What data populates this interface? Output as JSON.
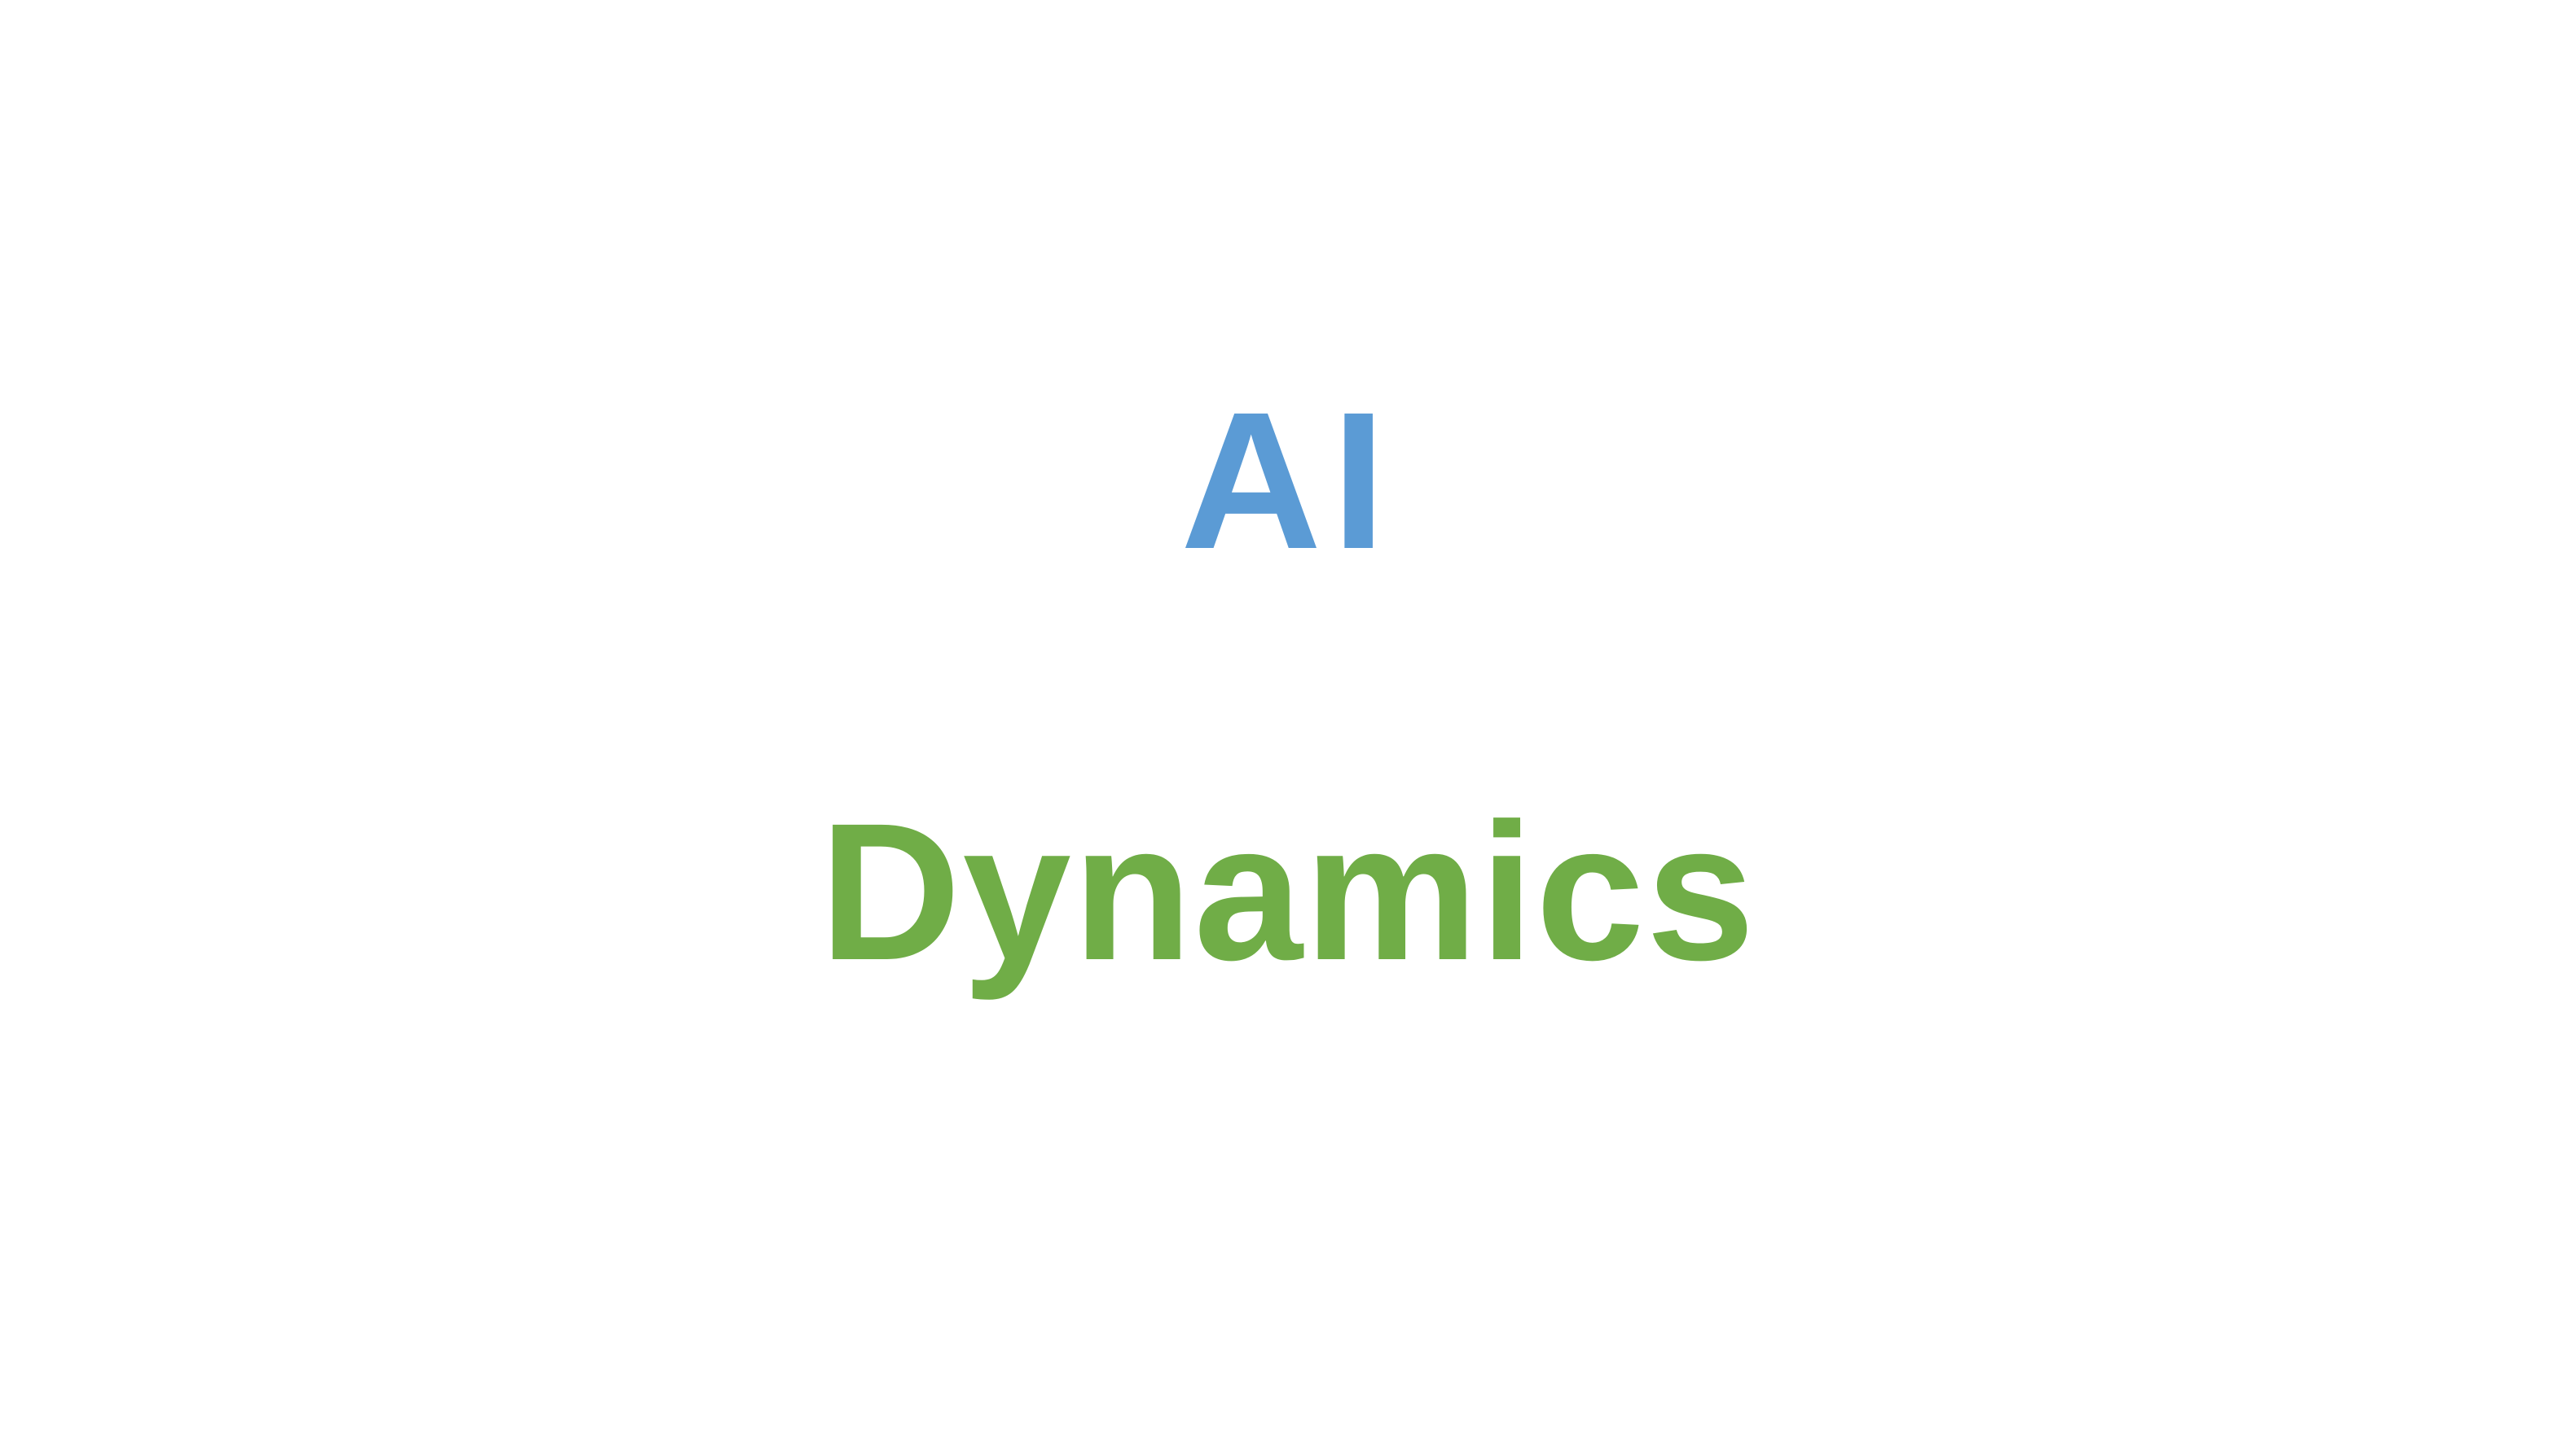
{
  "logo": {
    "line1": "AI",
    "line2": "Dynamics"
  },
  "colors": {
    "line1": "#5b9bd5",
    "line2": "#70ad47",
    "background": "#ffffff"
  }
}
